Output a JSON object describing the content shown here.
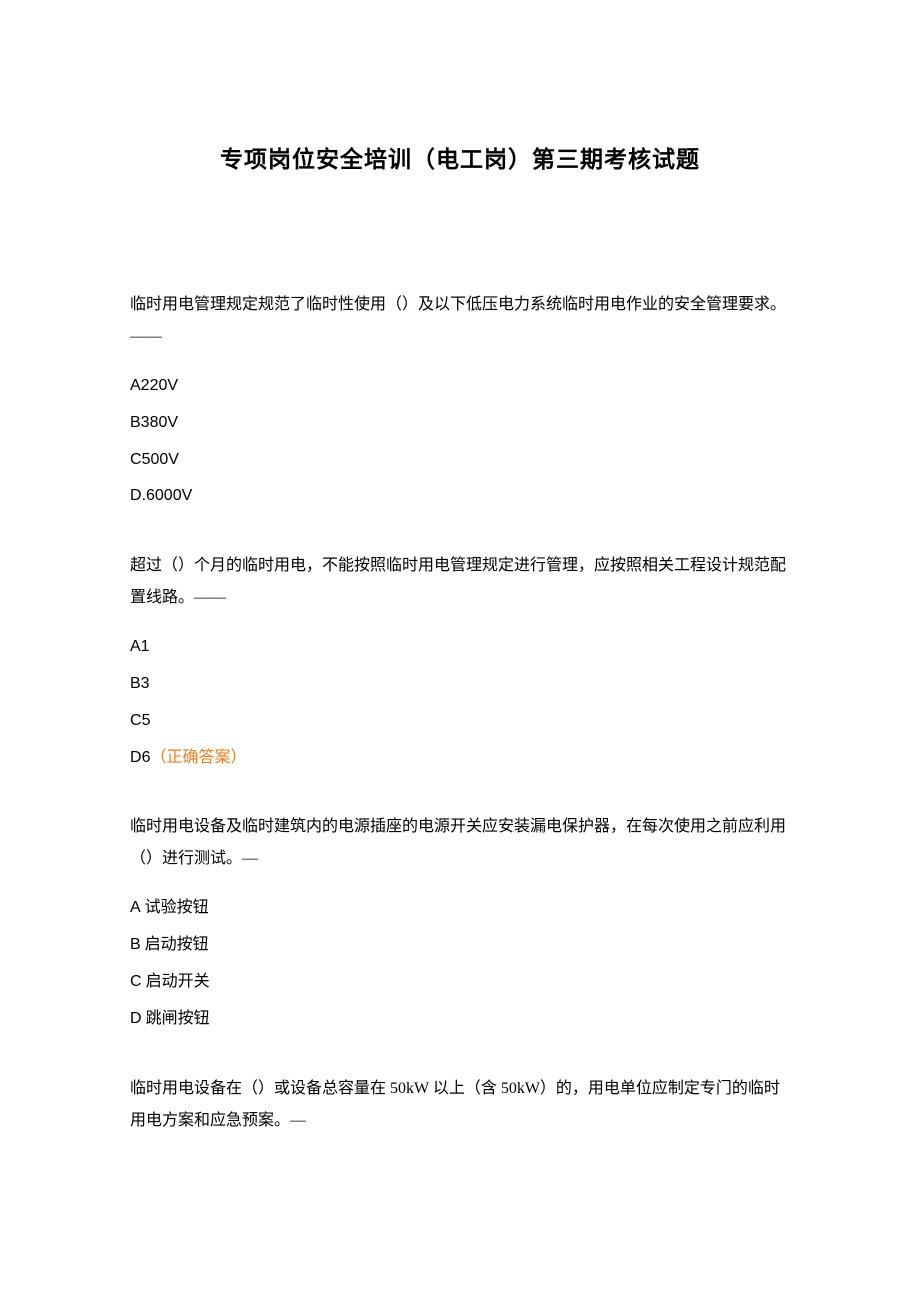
{
  "title": "专项岗位安全培训（电工岗）第三期考核试题",
  "questions": [
    {
      "text": "临时用电管理规定规范了临时性使用（）及以下低压电力系统临时用电作业的安全管理要求。——",
      "options": [
        {
          "label": "A",
          "text": "220V",
          "correct": false
        },
        {
          "label": "B",
          "text": "380V",
          "correct": false
        },
        {
          "label": "C",
          "text": "500V",
          "correct": false
        },
        {
          "label": "D",
          "text": ".6000V",
          "correct": false
        }
      ]
    },
    {
      "text": "超过（）个月的临时用电，不能按照临时用电管理规定进行管理，应按照相关工程设计规范配置线路。——",
      "options": [
        {
          "label": "A",
          "text": "1",
          "correct": false
        },
        {
          "label": "B",
          "text": "3",
          "correct": false
        },
        {
          "label": "C",
          "text": "5",
          "correct": false
        },
        {
          "label": "D",
          "text": "6",
          "correct": true
        }
      ]
    },
    {
      "text": "临时用电设备及临时建筑内的电源插座的电源开关应安装漏电保护器，在每次使用之前应利用（）进行测试。—",
      "options": [
        {
          "label": "A",
          "text": " 试验按钮",
          "correct": false
        },
        {
          "label": "B",
          "text": " 启动按钮",
          "correct": false
        },
        {
          "label": "C",
          "text": " 启动开关",
          "correct": false
        },
        {
          "label": "D",
          "text": " 跳闸按钮",
          "correct": false
        }
      ]
    },
    {
      "text": "临时用电设备在（）或设备总容量在 50kW 以上（含 50kW）的，用电单位应制定专门的临时用电方案和应急预案。—",
      "options": []
    }
  ],
  "correct_label": "（正确答案）"
}
